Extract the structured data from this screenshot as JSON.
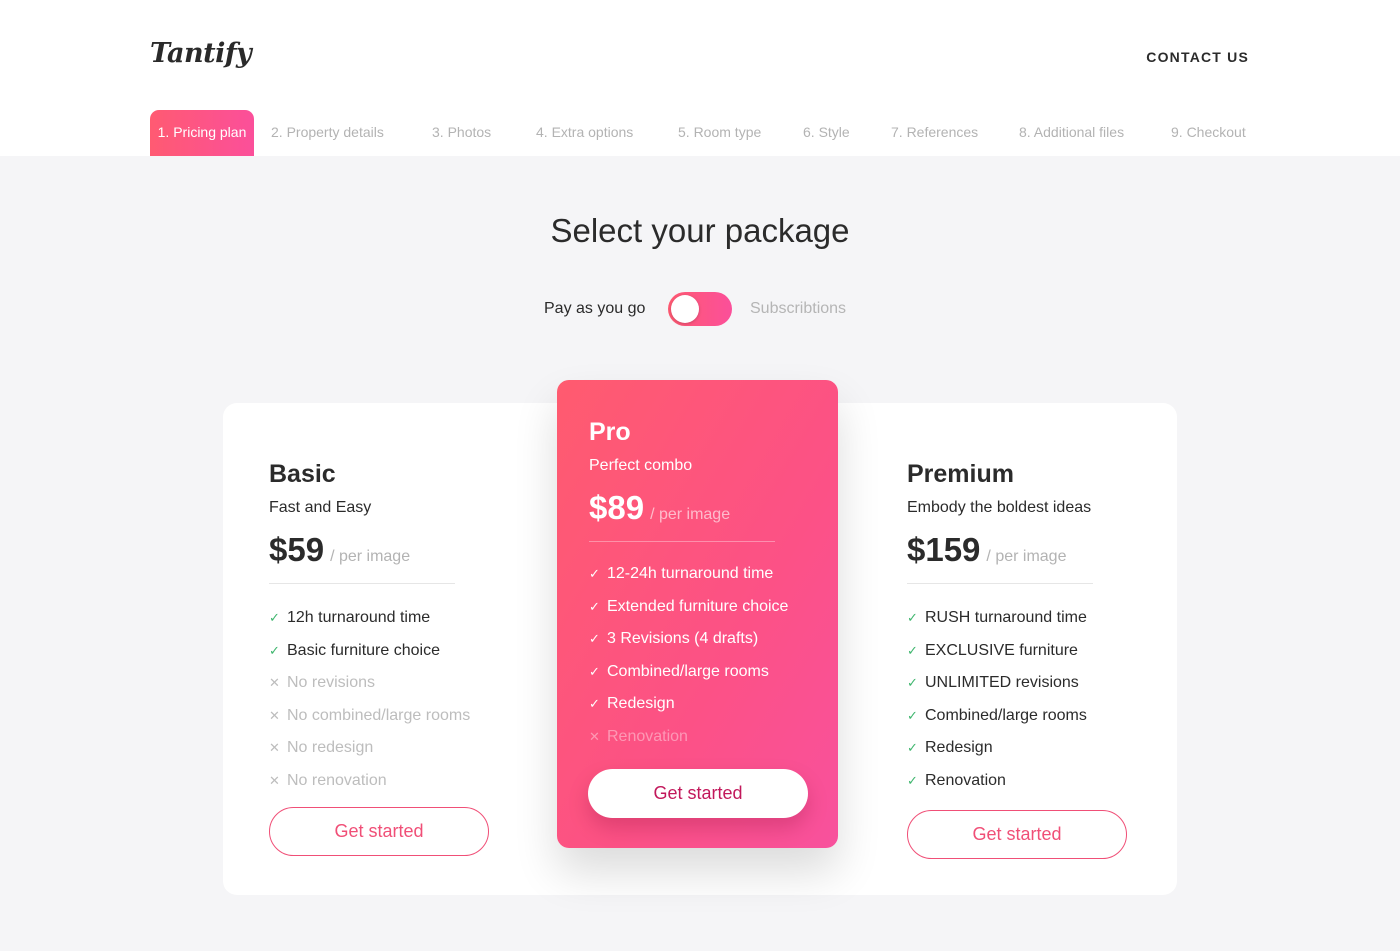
{
  "brand": {
    "logo_text": "Tantify",
    "accent_color": "#ff5a72",
    "accent_color_2": "#fb4f9a",
    "check_color": "#3fb66e"
  },
  "header": {
    "contact_label": "CONTACT US"
  },
  "steps": [
    {
      "label": "1. Pricing plan",
      "active": true
    },
    {
      "label": "2. Property details",
      "active": false
    },
    {
      "label": "3. Photos",
      "active": false
    },
    {
      "label": "4. Extra options",
      "active": false
    },
    {
      "label": "5. Room type",
      "active": false
    },
    {
      "label": "6. Style",
      "active": false
    },
    {
      "label": "7. References",
      "active": false
    },
    {
      "label": "8. Additional files",
      "active": false
    },
    {
      "label": "9. Checkout",
      "active": false
    }
  ],
  "main": {
    "title": "Select your package",
    "toggle": {
      "left_label": "Pay as you go",
      "right_label": "Subscribtions",
      "state": "pay-as-you-go"
    }
  },
  "plans": {
    "basic": {
      "name": "Basic",
      "tagline": "Fast and Easy",
      "price": "$59",
      "unit": "/ per image",
      "features": [
        {
          "text": "12h turnaround time",
          "included": true
        },
        {
          "text": "Basic furniture choice",
          "included": true
        },
        {
          "text": "No revisions",
          "included": false
        },
        {
          "text": "No combined/large rooms",
          "included": false
        },
        {
          "text": "No redesign",
          "included": false
        },
        {
          "text": "No renovation",
          "included": false
        }
      ],
      "cta": "Get started"
    },
    "pro": {
      "name": "Pro",
      "tagline": "Perfect combo",
      "price": "$89",
      "unit": "/ per image",
      "features": [
        {
          "text": "12-24h turnaround time",
          "included": true
        },
        {
          "text": "Extended furniture choice",
          "included": true
        },
        {
          "text": "3 Revisions (4 drafts)",
          "included": true
        },
        {
          "text": "Combined/large rooms",
          "included": true
        },
        {
          "text": "Redesign",
          "included": true
        },
        {
          "text": "Renovation",
          "included": false
        }
      ],
      "cta": "Get started"
    },
    "premium": {
      "name": "Premium",
      "tagline": "Embody the boldest ideas",
      "price": "$159",
      "unit": "/ per image",
      "features": [
        {
          "text": "RUSH turnaround time",
          "included": true
        },
        {
          "text": "EXCLUSIVE furniture",
          "included": true
        },
        {
          "text": "UNLIMITED revisions",
          "included": true
        },
        {
          "text": "Combined/large rooms",
          "included": true
        },
        {
          "text": "Redesign",
          "included": true
        },
        {
          "text": "Renovation",
          "included": true
        }
      ],
      "cta": "Get started"
    }
  },
  "icons": {
    "included": "check-icon",
    "excluded": "cross-icon"
  }
}
